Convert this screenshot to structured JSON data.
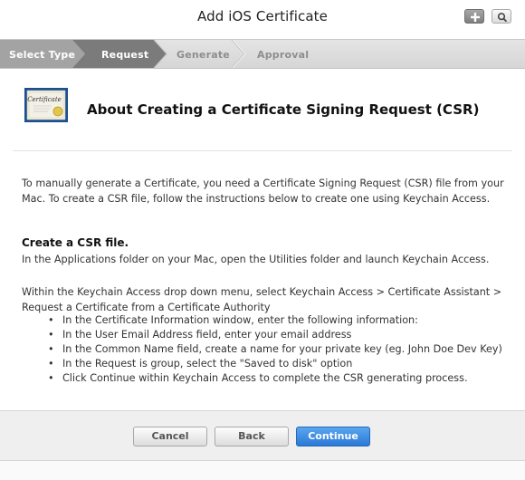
{
  "window": {
    "title": "Add iOS Certificate"
  },
  "steps": [
    {
      "label": "Select Type",
      "state": "completed"
    },
    {
      "label": "Request",
      "state": "active"
    },
    {
      "label": "Generate",
      "state": "upcoming"
    },
    {
      "label": "Approval",
      "state": "upcoming"
    }
  ],
  "icons": {
    "add": "plus-icon",
    "search": "search-icon",
    "certificate": "certificate-icon",
    "certificate_text": "Certificate"
  },
  "page": {
    "heading": "About Creating a Certificate Signing Request (CSR)",
    "intro": "To manually generate a Certificate, you need a Certificate Signing Request (CSR) file from your Mac. To create a CSR file, follow the instructions below to create one using Keychain Access.",
    "section_title": "Create a CSR file.",
    "section_text": "In the Applications folder on your Mac, open the Utilities folder and launch Keychain Access.",
    "menu_text": "Within the Keychain Access drop down menu, select Keychain Access > Certificate Assistant > Request a Certificate from a Certificate Authority",
    "bullets": [
      "In the Certificate Information window, enter the following information:",
      "In the User Email Address field, enter your email address",
      "In the Common Name field, create a name for your private key (eg. John Doe Dev Key)",
      "In the Request is group, select the \"Saved to disk\" option",
      "Click Continue within Keychain Access to complete the CSR generating process."
    ]
  },
  "footer": {
    "cancel_label": "Cancel",
    "back_label": "Back",
    "continue_label": "Continue"
  },
  "colors": {
    "step_completed": "#a3a3a3",
    "step_active": "#7d7d7d",
    "step_upcoming": "#dcdcdc",
    "primary": "#3a87e0"
  }
}
